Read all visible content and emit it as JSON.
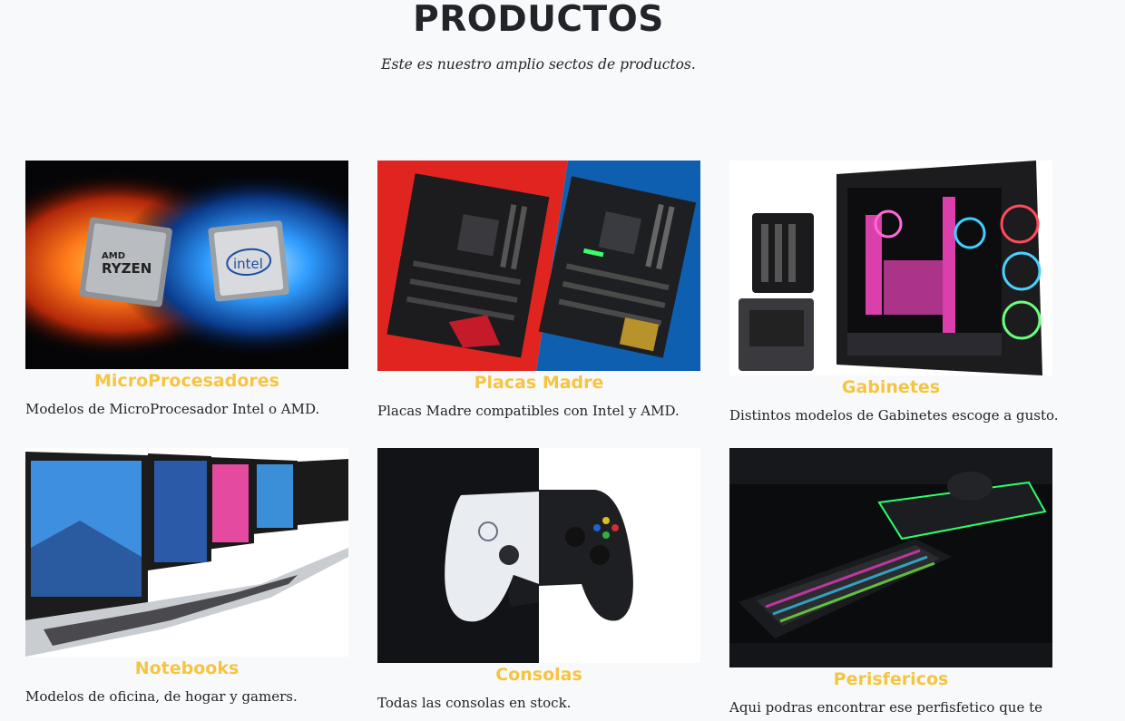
{
  "header": {
    "title": "PRODUCTOS",
    "subtitle": "Este es nuestro amplio sectos de productos."
  },
  "products": [
    {
      "name": "MicroProcesadores",
      "description": "Modelos de MicroProcesador Intel o AMD.",
      "image_labels": [
        "AMD",
        "RYZEN",
        "intel"
      ]
    },
    {
      "name": "Placas Madre",
      "description": "Placas Madre compatibles con Intel y AMD."
    },
    {
      "name": "Gabinetes",
      "description": "Distintos modelos de Gabinetes escoge a gusto."
    },
    {
      "name": "Notebooks",
      "description": "Modelos de oficina, de hogar y gamers."
    },
    {
      "name": "Consolas",
      "description": "Todas las consolas en stock."
    },
    {
      "name": "Perisfericos",
      "description": "Aqui podras encontrar ese perfisfetico que te"
    }
  ],
  "colors": {
    "background": "#f8f9fa",
    "title": "#212529",
    "product_name": "#f5c542"
  }
}
